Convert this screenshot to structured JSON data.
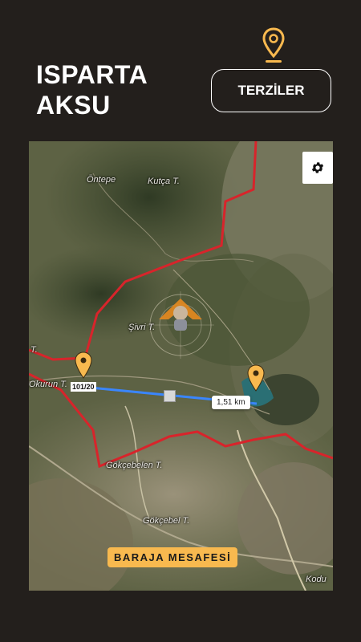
{
  "header": {
    "line1": "ISPARTA",
    "line2": "AKSU",
    "category_button": "TERZİLER"
  },
  "colors": {
    "background": "#231f1c",
    "accent": "#f8b94f",
    "boundary": "#d8242b",
    "route": "#3a86ff"
  },
  "icons": {
    "top_pin": "location-pin-icon",
    "settings": "gear-icon",
    "map_marker": "map-marker-icon"
  },
  "map": {
    "places": [
      {
        "name": "Öntepe"
      },
      {
        "name": "Kutça T."
      },
      {
        "name": "Şivri T."
      },
      {
        "name": "T."
      },
      {
        "name": "Okurun T."
      },
      {
        "name": "Gökçebelen T."
      },
      {
        "name": "Gökçebel T."
      },
      {
        "name": "Kodu"
      }
    ],
    "parcel_label": "101/20",
    "distance_label": "1,51 km",
    "bottom_label": "BARAJA MESAFESİ"
  }
}
